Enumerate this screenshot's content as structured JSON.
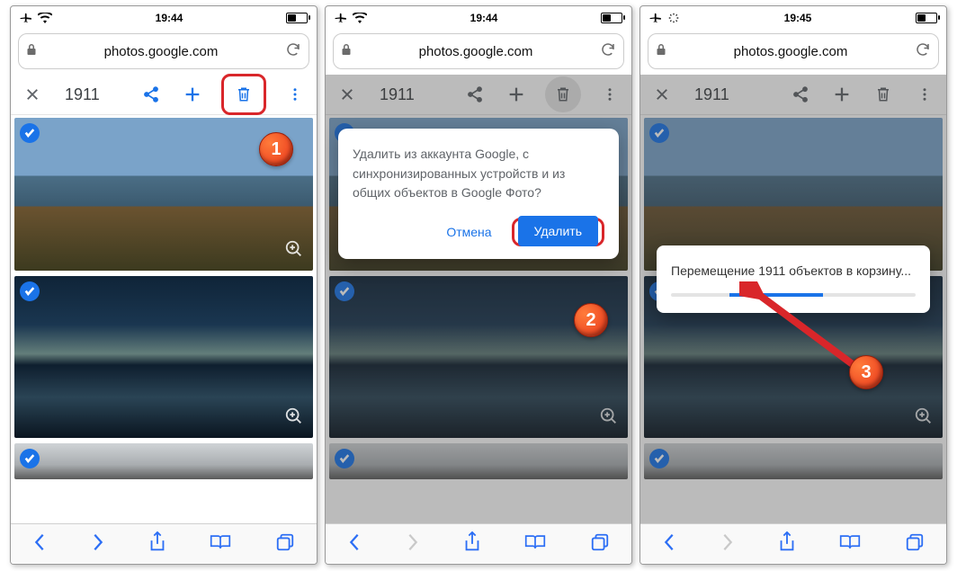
{
  "status": {
    "time1": "19:44",
    "time2": "19:44",
    "time3": "19:45"
  },
  "url": "photos.google.com",
  "selection": {
    "count": "1911"
  },
  "popover": {
    "message": "Удалить из аккаунта Google, с синхронизированных устройств и из общих объектов в Google Фото?",
    "cancel": "Отмена",
    "delete": "Удалить"
  },
  "toast": {
    "message": "Перемещение 1911 объектов в корзину..."
  },
  "callouts": {
    "c1": "1",
    "c2": "2",
    "c3": "3"
  }
}
